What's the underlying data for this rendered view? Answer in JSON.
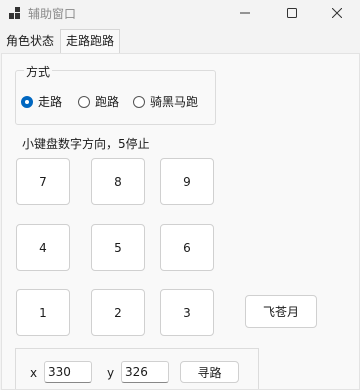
{
  "window": {
    "title": "辅助窗口",
    "icons": {
      "app": "app-icon",
      "minimize": "minimize-icon",
      "maximize": "maximize-icon",
      "close": "close-icon"
    }
  },
  "tabs": [
    {
      "label": "角色状态",
      "selected": false
    },
    {
      "label": "走路跑路",
      "selected": true
    }
  ],
  "mode_group": {
    "title": "方式",
    "options": [
      {
        "label": "走路",
        "checked": true
      },
      {
        "label": "跑路",
        "checked": false
      },
      {
        "label": "骑黑马跑",
        "checked": false
      }
    ]
  },
  "hint": "小键盘数字方向，5停止",
  "keypad": [
    "7",
    "8",
    "9",
    "4",
    "5",
    "6",
    "1",
    "2",
    "3"
  ],
  "fly_button": "飞苍月",
  "coords": {
    "x_label": "x",
    "x_value": "330",
    "y_label": "y",
    "y_value": "326",
    "find_button": "寻路"
  },
  "colors": {
    "accent": "#0067c0",
    "background": "#f3f3f3",
    "panel": "#f9f9f9"
  }
}
